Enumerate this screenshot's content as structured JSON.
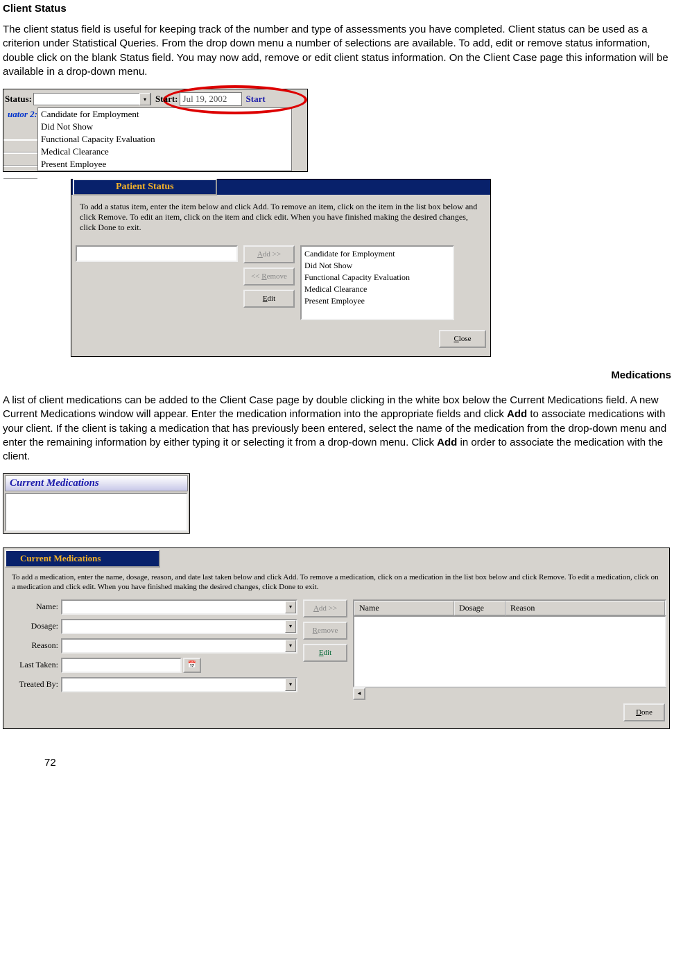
{
  "section1_heading": "Client Status",
  "section1_para": "The client status field is useful for keeping track of the number and type of assessments you have completed. Client status can be used as a criterion under Statistical Queries. From the drop down menu a number of selections are available. To add, edit or remove status information, double click on the blank Status field.  You may now add, remove or edit client status information. On the Client Case page this information will be available in a drop-down menu.",
  "shot1": {
    "status_label": "Status:",
    "start_label": "Start:",
    "start_date": "Jul 19, 2002",
    "start_right": "Start",
    "uator_label": "uator 2:",
    "options": [
      "Candidate for Employment",
      "Did Not Show",
      "Functional Capacity Evaluation",
      "Medical Clearance",
      "Present Employee"
    ]
  },
  "shot2": {
    "title": "Patient Status",
    "instructions": "To add a status item, enter the item below and click Add. To remove an item, click on the item in the list box below and click Remove. To edit an item, click on the item and click edit. When you have finished making the desired changes, click Done to exit.",
    "add_btn": "Add >>",
    "remove_btn": "<< Remove",
    "edit_btn": "Edit",
    "close_btn": "Close",
    "items": [
      "Candidate for Employment",
      "Did Not Show",
      "Functional Capacity Evaluation",
      "Medical Clearance",
      "Present Employee"
    ]
  },
  "section2_heading": "Medications",
  "section2_para_a": "A list of client medications can be added to the Client Case page by double clicking in the white box below the Current Medications field. A new Current Medications window will appear.  Enter the medication information into the appropriate fields and click ",
  "section2_bold1": "Add",
  "section2_para_b": " to associate medications with your client. If the client is taking a medication that has previously been entered, select the name of the medication from the drop-down menu and enter the remaining information by either typing it or selecting it from a drop-down menu. Click ",
  "section2_bold2": "Add",
  "section2_para_c": " in order to associate the medication with the client.",
  "shot3": {
    "title": "Current Medications"
  },
  "shot4": {
    "title": "Current Medications",
    "instructions": "To add a medication, enter the name, dosage, reason, and date last taken below and click Add. To remove a medication, click on a medication in the list box below and click Remove. To edit a medication, click on a medication and click edit. When you have finished making the desired changes, click Done to exit.",
    "labels": {
      "name": "Name:",
      "dosage": "Dosage:",
      "reason": "Reason:",
      "last_taken": "Last Taken:",
      "treated_by": "Treated By:"
    },
    "add_btn": "Add >>",
    "remove_btn": "Remove",
    "edit_btn": "Edit",
    "done_btn": "Done",
    "columns": {
      "name": "Name",
      "dosage": "Dosage",
      "reason": "Reason"
    }
  },
  "page_number": "72"
}
